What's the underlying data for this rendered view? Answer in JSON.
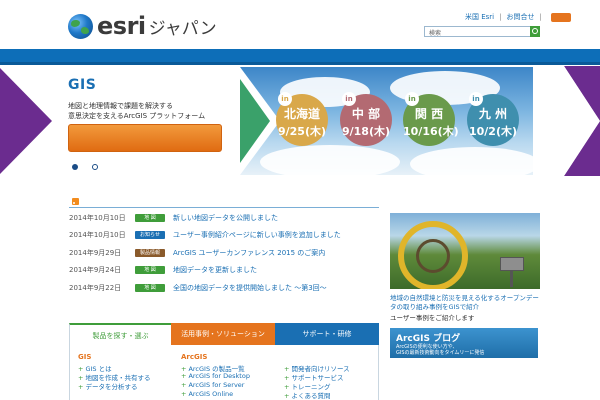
{
  "header": {
    "logo_word": "esri",
    "logo_jp": "ジャパン",
    "top_link_1": "米国 Esri",
    "top_link_2": "お問合せ",
    "search_placeholder": "検索"
  },
  "hero": {
    "title": "GIS",
    "line1": "地図と地理情報で課題を解決する",
    "line2": "意思決定を支えるArcGIS プラットフォーム",
    "carousel_dots": 2,
    "active_dot": 1,
    "banner": {
      "badge": "in",
      "events": [
        {
          "region": "北海道",
          "date": "9/25(木)"
        },
        {
          "region": "中 部",
          "date": "9/18(木)"
        },
        {
          "region": "関 西",
          "date": "10/16(木)"
        },
        {
          "region": "九 州",
          "date": "10/2(木)"
        }
      ]
    }
  },
  "news": {
    "items": [
      {
        "date": "2014年10月10日",
        "tag": "地 図",
        "tag_color": "#3f9d3a",
        "title": "新しい地図データを公開しました"
      },
      {
        "date": "2014年10月10日",
        "tag": "お知らせ",
        "tag_color": "#1a6fb3",
        "title": "ユーザー事例紹介ページに新しい事例を追加しました"
      },
      {
        "date": "2014年9月29日",
        "tag": "製品情報",
        "tag_color": "#8a5a2b",
        "title": "ArcGIS ユーザーカンファレンス 2015 のご案内"
      },
      {
        "date": "2014年9月24日",
        "tag": "地 図",
        "tag_color": "#3f9d3a",
        "title": "地図データを更新しました"
      },
      {
        "date": "2014年9月22日",
        "tag": "地 図",
        "tag_color": "#3f9d3a",
        "title": "全国の地図データを提供開始しました 〜第3回〜"
      }
    ]
  },
  "sidebar": {
    "caption_link": "地域の自然環境と防災を見える化するオープンデータの取り組み事例をGISで紹介",
    "caption_text": "ユーザー事例をご紹介します",
    "blog_title": "ArcGIS ブログ",
    "blog_sub_1": "ArcGISの便利な使い方や、",
    "blog_sub_2": "GISの最新技術動向をタイムリーに発信"
  },
  "tabs": {
    "tab1": "製品を探す・選ぶ",
    "tab2": "活用事例・ソリューション",
    "tab3": "サポート・研修",
    "col1_head": "GIS",
    "col1_items": [
      "GIS とは",
      "地図を作成・共有する",
      "データを分析する"
    ],
    "col2_head": "ArcGIS",
    "col2_items": [
      "ArcGIS の製品一覧",
      "ArcGIS for Desktop",
      "ArcGIS for Server",
      "ArcGIS Online"
    ],
    "col3_items": [
      "開発者向けリソース",
      "サポートサービス",
      "トレーニング",
      "よくある質問"
    ]
  },
  "colors": {
    "brand_blue": "#1a6fb3",
    "nav_blue": "#0d6eb8",
    "accent_orange": "#e5741e",
    "accent_green": "#3f9d3a",
    "side_purple": "#6b2c8f"
  }
}
